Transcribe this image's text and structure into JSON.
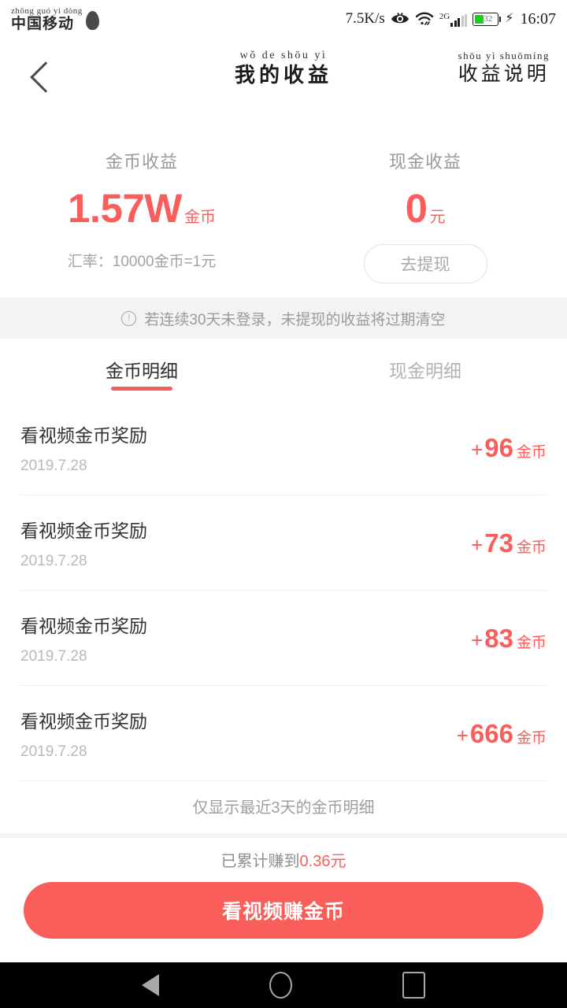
{
  "status_bar": {
    "carrier_pinyin": "zhōng guó  yi dòng",
    "carrier": "中国移动",
    "net_speed": "7.5K/s",
    "network_type": "2G",
    "battery_level": "32",
    "time": "16:07",
    "icons": [
      "eye-icon",
      "wifi-icon",
      "signal-icon",
      "battery-icon",
      "charging-bolt-icon"
    ]
  },
  "header": {
    "back_icon": "chevron-left-icon",
    "title_pinyin": "wǒ  de shōu yì",
    "title": "我的收益",
    "rule_pinyin": "shōu yì shuōmíng",
    "rule_label": "收益说明"
  },
  "summary": {
    "coin": {
      "label": "金币收益",
      "amount": "1.57W",
      "unit": "金币",
      "rate": "汇率：10000金币=1元"
    },
    "cash": {
      "label": "现金收益",
      "amount": "0",
      "unit": "元",
      "withdraw_label": "去提现"
    }
  },
  "notice": {
    "icon": "info-circle-icon",
    "text": "若连续30天未登录，未提现的收益将过期清空"
  },
  "tabs": [
    {
      "label": "金币明细",
      "active": true
    },
    {
      "label": "现金明细",
      "active": false
    }
  ],
  "list": {
    "rows": [
      {
        "title": "看视频金币奖励",
        "date": "2019.7.28",
        "sign": "+",
        "amount": "96",
        "unit": "金币"
      },
      {
        "title": "看视频金币奖励",
        "date": "2019.7.28",
        "sign": "+",
        "amount": "73",
        "unit": "金币"
      },
      {
        "title": "看视频金币奖励",
        "date": "2019.7.28",
        "sign": "+",
        "amount": "83",
        "unit": "金币"
      },
      {
        "title": "看视频金币奖励",
        "date": "2019.7.28",
        "sign": "+",
        "amount": "666",
        "unit": "金币"
      }
    ],
    "footer_note": "仅显示最近3天的金币明细"
  },
  "bottom": {
    "cumulative_prefix": "已累计赚到",
    "cumulative_value": "0.36元",
    "cta_label": "看视频赚金币"
  },
  "nav_bar": {
    "back": "nav-back-icon",
    "home": "nav-home-icon",
    "recent": "nav-recent-icon"
  },
  "colors": {
    "accent": "#fa5e5b",
    "banner_bg": "#f3f3f3",
    "muted_text": "#9b9b9b"
  }
}
